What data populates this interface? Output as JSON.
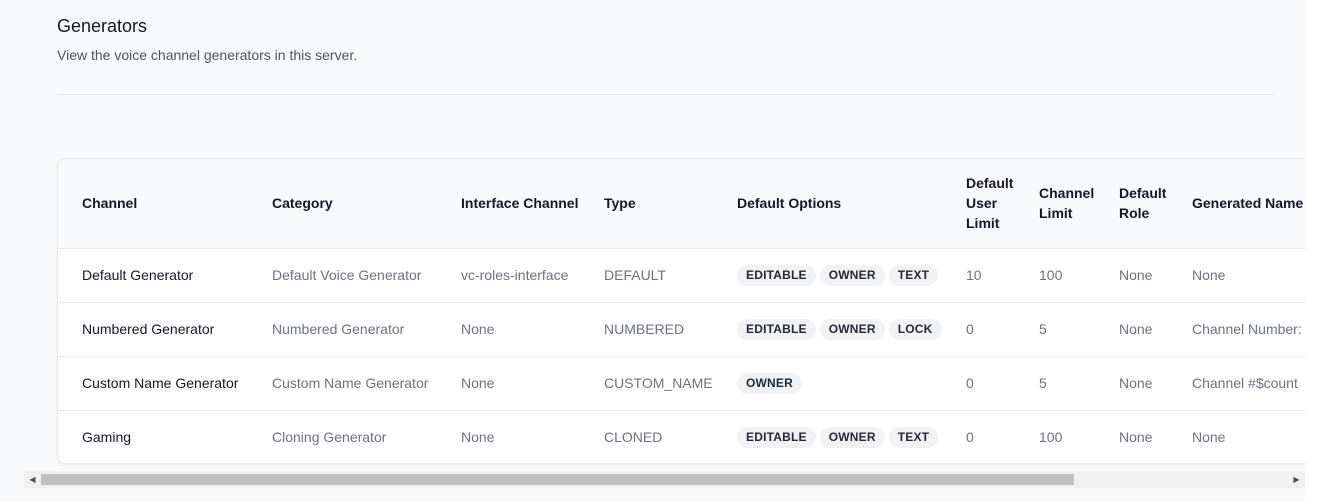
{
  "header": {
    "title": "Generators",
    "subtitle": "View the voice channel generators in this server."
  },
  "table": {
    "columns": [
      {
        "label": "Channel"
      },
      {
        "label": "Category"
      },
      {
        "label": "Interface Channel"
      },
      {
        "label": "Type"
      },
      {
        "label": "Default Options"
      },
      {
        "label": "Default User Limit"
      },
      {
        "label": "Channel Limit"
      },
      {
        "label": "Default Role"
      },
      {
        "label": "Generated Name"
      }
    ],
    "rows": [
      {
        "channel": "Default Generator",
        "category": "Default Voice Generator",
        "interface": "vc-roles-interface",
        "type": "DEFAULT",
        "options": [
          "EDITABLE",
          "OWNER",
          "TEXT"
        ],
        "user_limit": "10",
        "channel_limit": "100",
        "role": "None",
        "generated_name": "None"
      },
      {
        "channel": "Numbered Generator",
        "category": "Numbered Generator",
        "interface": "None",
        "type": "NUMBERED",
        "options": [
          "EDITABLE",
          "OWNER",
          "LOCK"
        ],
        "user_limit": "0",
        "channel_limit": "5",
        "role": "None",
        "generated_name": "Channel Number:"
      },
      {
        "channel": "Custom Name Generator",
        "category": "Custom Name Generator",
        "interface": "None",
        "type": "CUSTOM_NAME",
        "options": [
          "OWNER"
        ],
        "user_limit": "0",
        "channel_limit": "5",
        "role": "None",
        "generated_name": "Channel #$count"
      },
      {
        "channel": "Gaming",
        "category": "Cloning Generator",
        "interface": "None",
        "type": "CLONED",
        "options": [
          "EDITABLE",
          "OWNER",
          "TEXT"
        ],
        "user_limit": "0",
        "channel_limit": "100",
        "role": "None",
        "generated_name": "None"
      }
    ]
  },
  "scrollbar": {
    "left_arrow_icon": "chevron-left-icon",
    "right_arrow_icon": "chevron-right-icon"
  }
}
